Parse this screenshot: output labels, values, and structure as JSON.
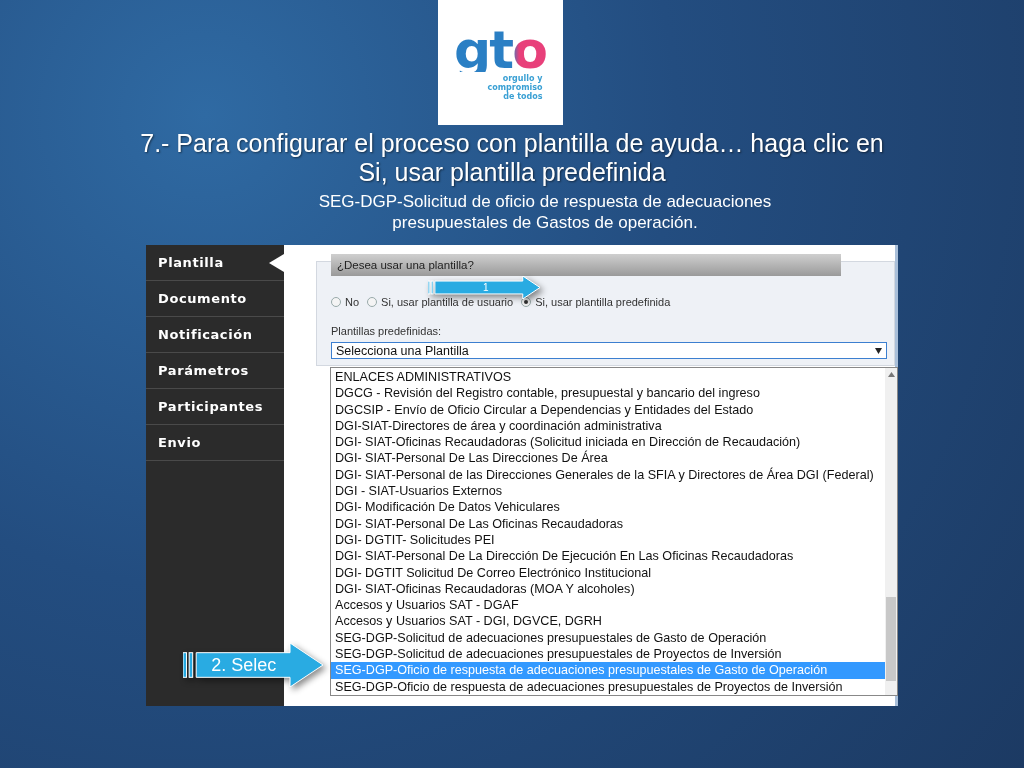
{
  "logo": {
    "wordmark": "gto",
    "tagline": "orgullo y\ncompromiso\nde todos"
  },
  "title": "7.- Para configurar el proceso con plantilla de ayuda… haga clic en Si, usar plantilla predefinida",
  "subtitle": "SEG-DGP-Solicitud de oficio de respuesta de adecuaciones presupuestales de Gastos de operación.",
  "sidebar": {
    "items": [
      {
        "label": "Plantilla",
        "selected": true
      },
      {
        "label": "Documento",
        "selected": false
      },
      {
        "label": "Notificación",
        "selected": false
      },
      {
        "label": "Parámetros",
        "selected": false
      },
      {
        "label": "Participantes",
        "selected": false
      },
      {
        "label": "Envio",
        "selected": false
      }
    ]
  },
  "form": {
    "heading": "¿Desea usar una plantilla?",
    "radios": [
      {
        "label": "No",
        "selected": false
      },
      {
        "label": "Si, usar plantilla de usuario",
        "selected": false
      },
      {
        "label": "Si, usar plantilla predefinida",
        "selected": true
      }
    ],
    "list_label": "Plantillas predefinidas:",
    "select": {
      "value": "Selecciona una Plantilla",
      "expanded": true
    },
    "options": [
      {
        "label": "ENLACES ADMINISTRATIVOS",
        "selected": false
      },
      {
        "label": "DGCG - Revisión del Registro contable, presupuestal y bancario del ingreso",
        "selected": false
      },
      {
        "label": "DGCSIP - Envío de Oficio Circular a Dependencias y Entidades del Estado",
        "selected": false
      },
      {
        "label": "DGI-SIAT-Directores de área y coordinación administrativa",
        "selected": false
      },
      {
        "label": "DGI- SIAT-Oficinas Recaudadoras (Solicitud iniciada en Dirección de Recaudación)",
        "selected": false
      },
      {
        "label": "DGI- SIAT-Personal De Las Direcciones De Área",
        "selected": false
      },
      {
        "label": "DGI- SIAT-Personal de las Direcciones Generales de la SFIA y Directores de Área DGI (Federal)",
        "selected": false
      },
      {
        "label": "DGI - SIAT-Usuarios Externos",
        "selected": false
      },
      {
        "label": "DGI- Modificación De Datos Vehiculares",
        "selected": false
      },
      {
        "label": "DGI- SIAT-Personal De Las Oficinas Recaudadoras",
        "selected": false
      },
      {
        "label": "DGI- DGTIT- Solicitudes PEI",
        "selected": false
      },
      {
        "label": "DGI- SIAT-Personal De La Dirección De Ejecución En Las Oficinas Recaudadoras",
        "selected": false
      },
      {
        "label": "DGI- DGTIT Solicitud De Correo Electrónico Institucional",
        "selected": false
      },
      {
        "label": "DGI- SIAT-Oficinas Recaudadoras (MOA Y alcoholes)",
        "selected": false
      },
      {
        "label": "Accesos y Usuarios SAT - DGAF",
        "selected": false
      },
      {
        "label": "Accesos y Usuarios SAT - DGI, DGVCE, DGRH",
        "selected": false
      },
      {
        "label": "SEG-DGP-Solicitud de adecuaciones presupuestales de Gasto de Operación",
        "selected": false
      },
      {
        "label": "SEG-DGP-Solicitud de adecuaciones presupuestales de Proyectos de Inversión",
        "selected": false
      },
      {
        "label": "SEG-DGP-Oficio de respuesta de adecuaciones presupuestales de Gasto de Operación",
        "selected": true
      },
      {
        "label": "SEG-DGP-Oficio de respuesta de adecuaciones presupuestales de Proyectos de Inversión",
        "selected": false
      }
    ]
  },
  "callouts": [
    {
      "label": "1"
    },
    {
      "label": "2. Selec"
    }
  ]
}
